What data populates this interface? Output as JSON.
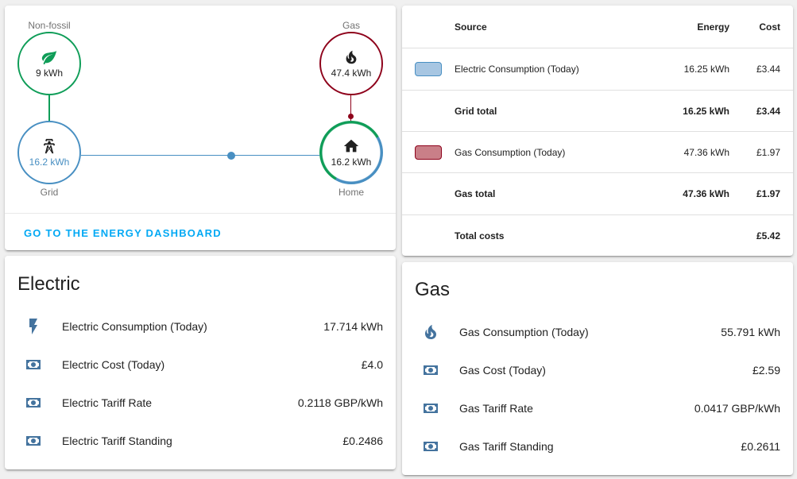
{
  "distribution": {
    "nonfossil": {
      "label": "Non-fossil",
      "value": "9 kWh"
    },
    "gas": {
      "label": "Gas",
      "value": "47.4 kWh"
    },
    "grid": {
      "label": "Grid",
      "value": "16.2 kWh"
    },
    "home": {
      "label": "Home",
      "value": "16.2 kWh"
    },
    "action": "GO TO THE ENERGY DASHBOARD"
  },
  "sources": {
    "headers": {
      "source": "Source",
      "energy": "Energy",
      "cost": "Cost"
    },
    "rows": [
      {
        "name": "Electric Consumption (Today)",
        "energy": "16.25 kWh",
        "cost": "£3.44"
      },
      {
        "name": "Grid total",
        "energy": "16.25 kWh",
        "cost": "£3.44"
      },
      {
        "name": "Gas Consumption (Today)",
        "energy": "47.36 kWh",
        "cost": "£1.97"
      },
      {
        "name": "Gas total",
        "energy": "47.36 kWh",
        "cost": "£1.97"
      },
      {
        "name": "Total costs",
        "energy": "",
        "cost": "£5.42"
      }
    ]
  },
  "electric": {
    "title": "Electric",
    "entities": [
      {
        "name": "Electric Consumption (Today)",
        "state": "17.714 kWh",
        "icon": "flash-icon"
      },
      {
        "name": "Electric Cost (Today)",
        "state": "£4.0",
        "icon": "cash-icon"
      },
      {
        "name": "Electric Tariff Rate",
        "state": "0.2118 GBP/kWh",
        "icon": "cash-icon"
      },
      {
        "name": "Electric Tariff Standing",
        "state": "£0.2486",
        "icon": "cash-icon"
      }
    ]
  },
  "gas": {
    "title": "Gas",
    "entities": [
      {
        "name": "Gas Consumption (Today)",
        "state": "55.791 kWh",
        "icon": "fire-icon"
      },
      {
        "name": "Gas Cost (Today)",
        "state": "£2.59",
        "icon": "cash-icon"
      },
      {
        "name": "Gas Tariff Rate",
        "state": "0.0417 GBP/kWh",
        "icon": "cash-icon"
      },
      {
        "name": "Gas Tariff Standing",
        "state": "£0.2611",
        "icon": "cash-icon"
      }
    ]
  },
  "colors": {
    "nonfossil": "#0f9d58",
    "gas": "#8e021b",
    "grid": "#488fc2",
    "accent": "#03a9f4",
    "icon": "#44739e",
    "electric_swatch_fill": "#a7c6e2",
    "electric_swatch_border": "#488fc2",
    "gas_swatch_fill": "#c97f88",
    "gas_swatch_border": "#8e021b"
  }
}
